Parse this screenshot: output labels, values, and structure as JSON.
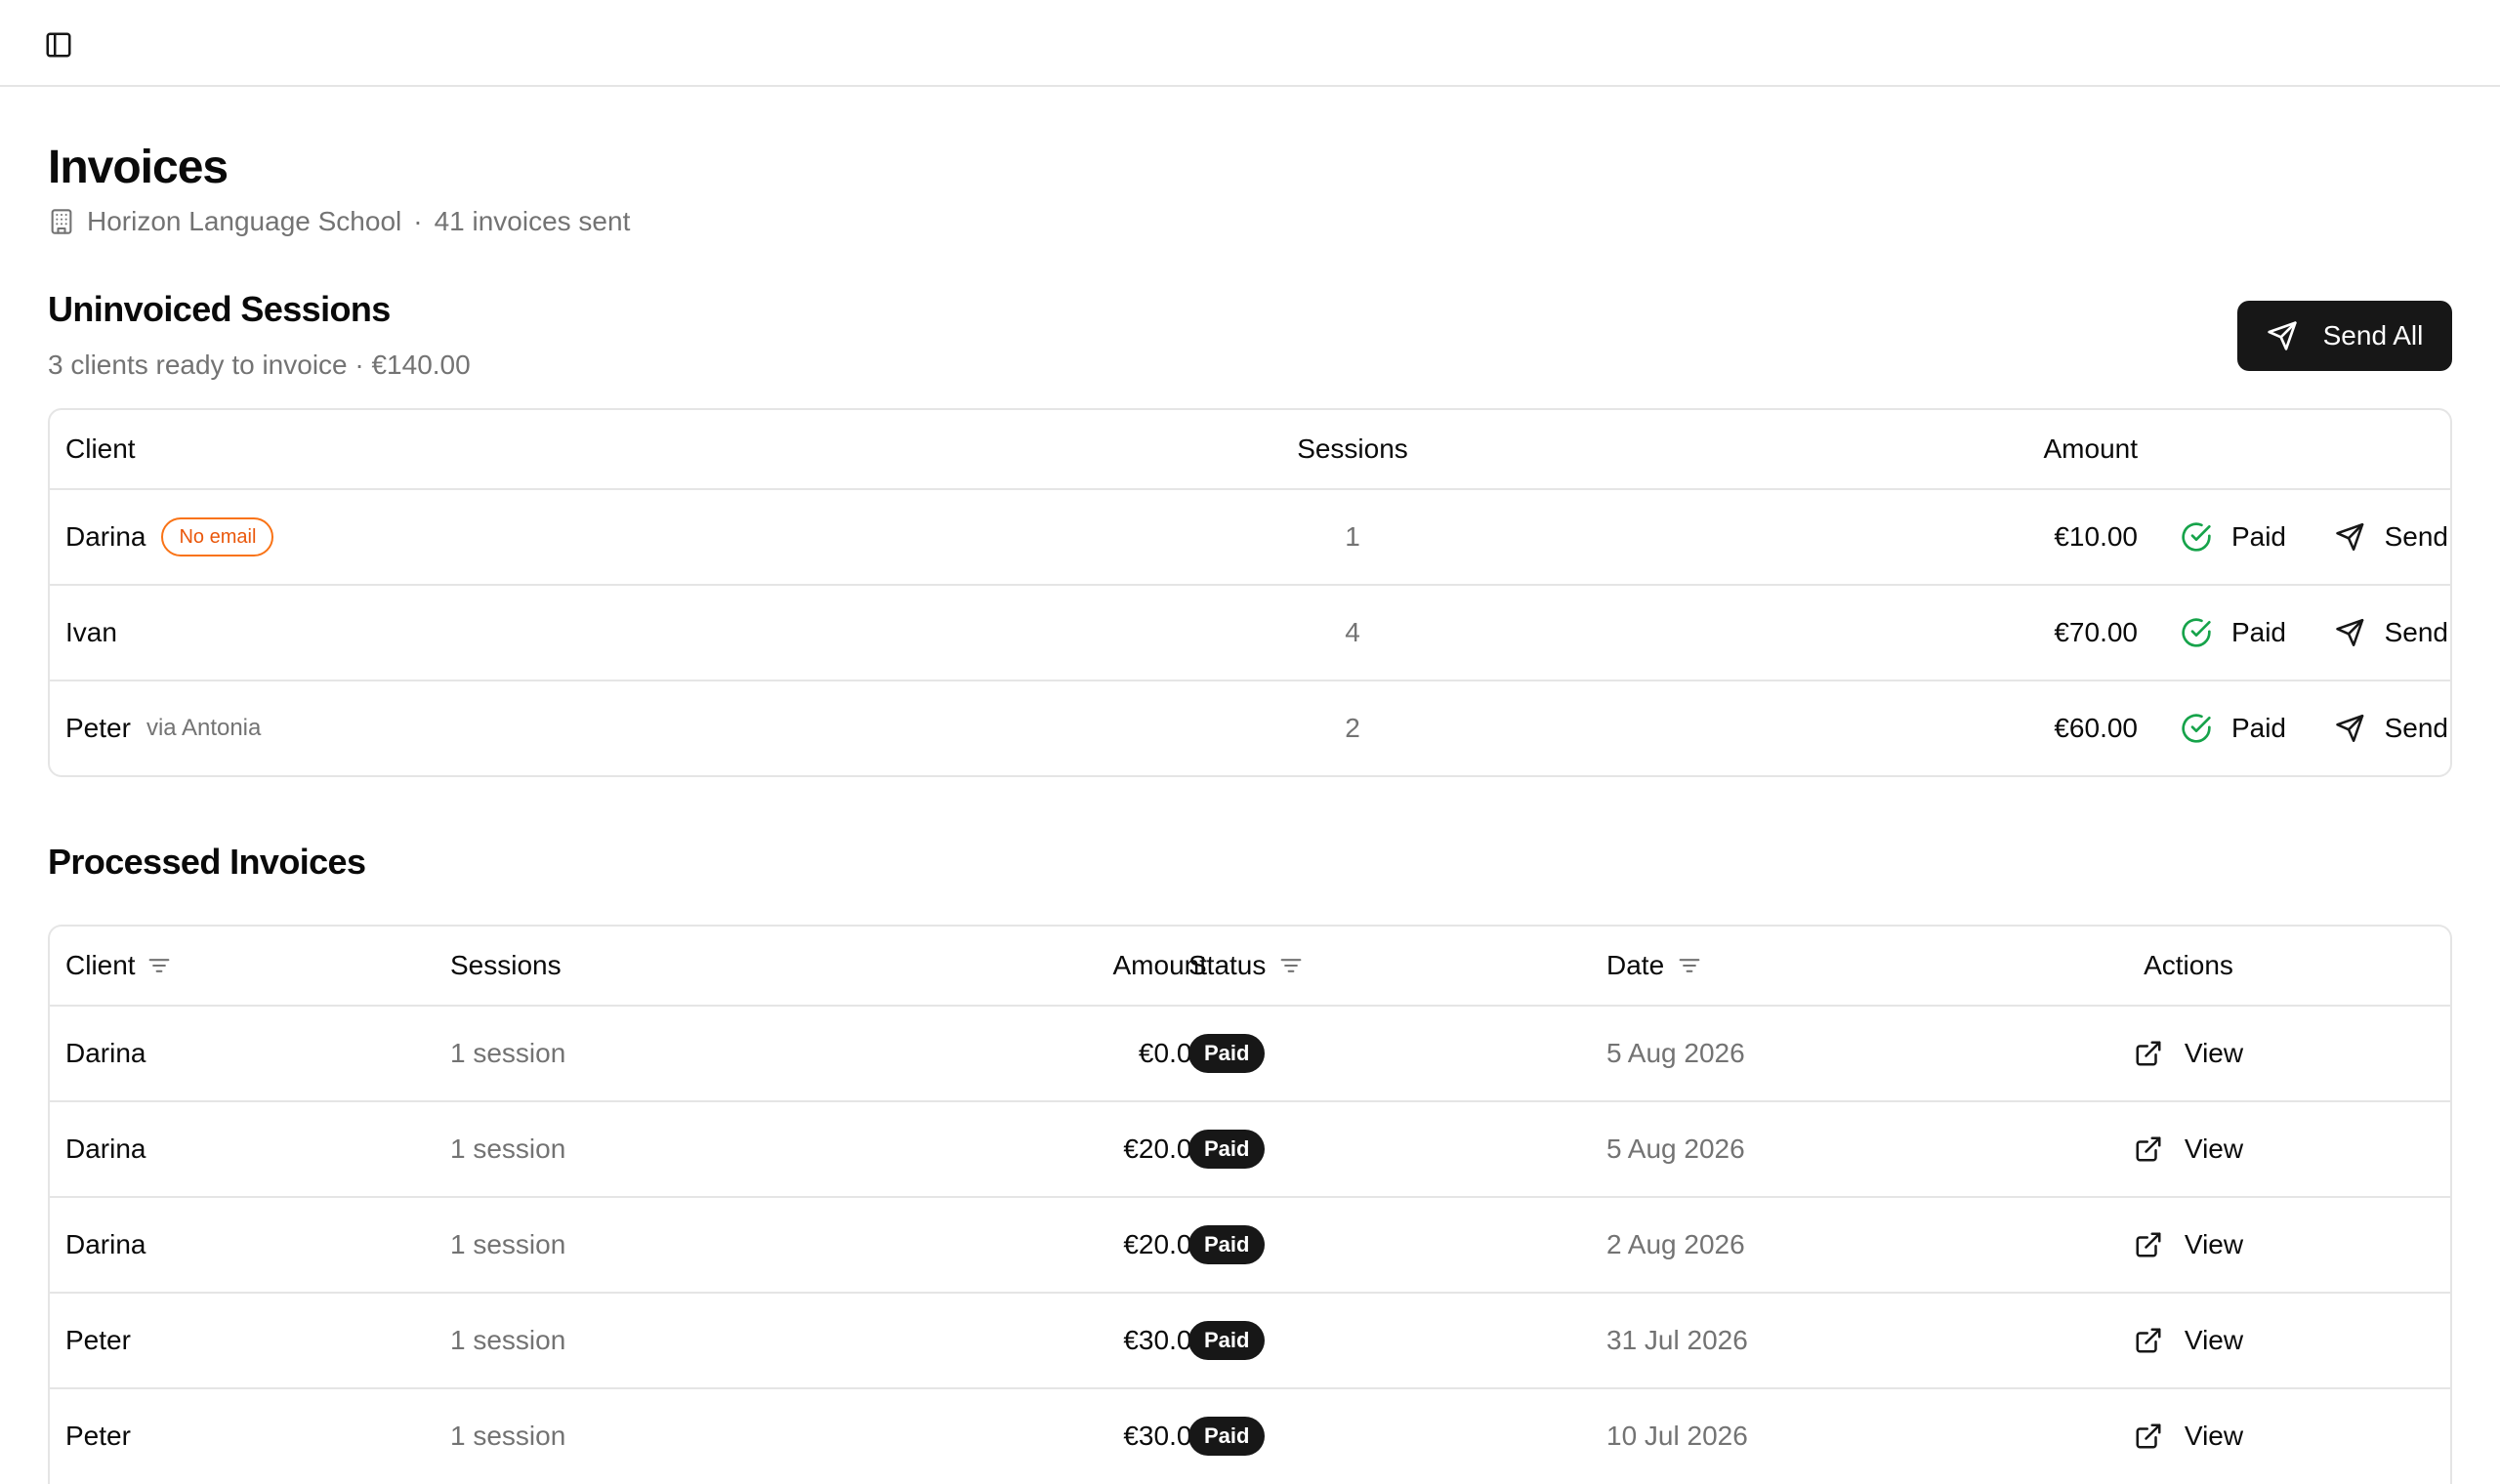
{
  "header": {
    "sidebar_toggle_icon": "panel-left-icon"
  },
  "page": {
    "title": "Invoices",
    "org_icon": "building-icon",
    "org_name": "Horizon Language School",
    "separator": "·",
    "invoices_sent": "41 invoices sent"
  },
  "uninvoiced": {
    "title": "Uninvoiced Sessions",
    "subtitle": "3 clients ready to invoice · €140.00",
    "send_all_label": "Send All",
    "columns": {
      "client": "Client",
      "sessions": "Sessions",
      "amount": "Amount"
    },
    "rows": [
      {
        "client": "Darina",
        "badge": "No email",
        "via": "",
        "sessions": "1",
        "amount": "€10.00",
        "paid_label": "Paid",
        "send_label": "Send"
      },
      {
        "client": "Ivan",
        "badge": "",
        "via": "",
        "sessions": "4",
        "amount": "€70.00",
        "paid_label": "Paid",
        "send_label": "Send"
      },
      {
        "client": "Peter",
        "badge": "",
        "via": "via Antonia",
        "sessions": "2",
        "amount": "€60.00",
        "paid_label": "Paid",
        "send_label": "Send"
      }
    ]
  },
  "processed": {
    "title": "Processed Invoices",
    "columns": {
      "client": "Client",
      "sessions": "Sessions",
      "amount": "Amount",
      "status": "Status",
      "date": "Date",
      "actions": "Actions"
    },
    "rows": [
      {
        "client": "Darina",
        "sessions": "1 session",
        "amount": "€0.00",
        "status": "Paid",
        "date": "5 Aug 2026",
        "action": "View"
      },
      {
        "client": "Darina",
        "sessions": "1 session",
        "amount": "€20.00",
        "status": "Paid",
        "date": "5 Aug 2026",
        "action": "View"
      },
      {
        "client": "Darina",
        "sessions": "1 session",
        "amount": "€20.00",
        "status": "Paid",
        "date": "2 Aug 2026",
        "action": "View"
      },
      {
        "client": "Peter",
        "sessions": "1 session",
        "amount": "€30.00",
        "status": "Paid",
        "date": "31 Jul 2026",
        "action": "View"
      },
      {
        "client": "Peter",
        "sessions": "1 session",
        "amount": "€30.00",
        "status": "Paid",
        "date": "10 Jul 2026",
        "action": "View"
      }
    ]
  },
  "colors": {
    "paid_check": "#16a34a",
    "no_email_badge": "#ea580c",
    "primary": "#171717",
    "muted": "#737373",
    "border": "#e5e5e5"
  }
}
